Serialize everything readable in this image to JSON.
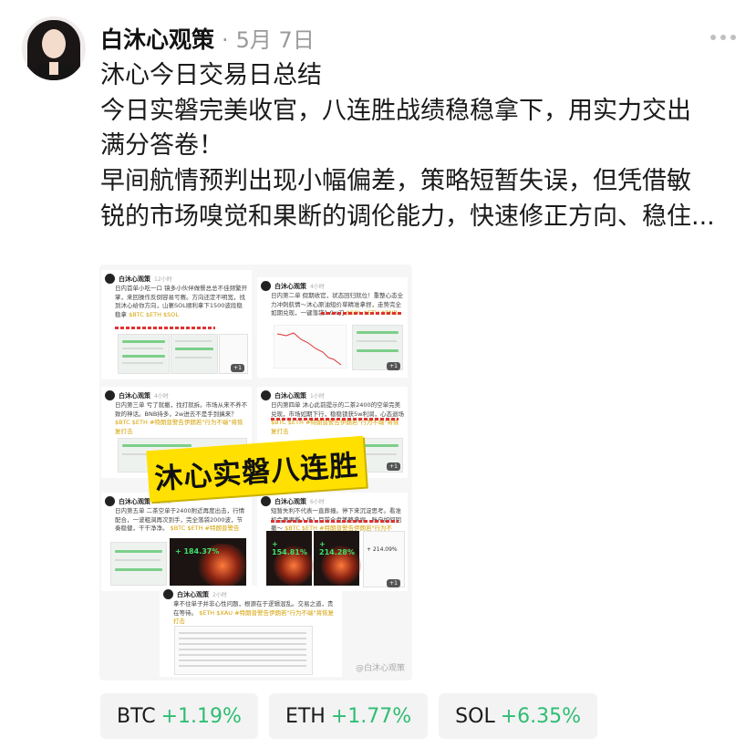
{
  "post": {
    "author": "白沐心观策",
    "separator": "·",
    "date": "5月 7日",
    "lines": [
      "沐心今日交易日总结",
      "今日实磐完美收官，八连胜战绩稳稳拿下，用实力交出",
      "满分答卷！",
      "早间航情预判出现小幅偏差，策略短暂失误，但凭借敏",
      "锐的市场嗅觉和果断的调伦能力，快速修正方向、稳住..."
    ]
  },
  "image": {
    "banner": "沐心实磐八连胜",
    "watermark": "@白沐心观策",
    "cards": [
      {
        "name": "白沐心观策",
        "time": "12小时",
        "text": "日内首单小吃一口 镜多小伙伴做餐总总不佳频繁开掌，来回操作反倒容易亏赛。方向还定不明宽，找到沐心给你方向，山寨SOL顺利拿下1500波段稳稳拿",
        "tags": "$BTC $ETH $SOL",
        "count": "+1"
      },
      {
        "name": "白沐心观策",
        "time": "4小时",
        "text": "日内第二单 假期收官，状态回归就位！重整心态全力冲刺航情～沐心原油短价草精准拿捏，走势完全如期兑现，一键落袋1.9w刀",
        "tags": "$SOL $ETH $BNB",
        "count": "+1"
      },
      {
        "name": "白沐心观策",
        "time": "4小时",
        "text": "日内第三单 亏了就撤，找打就拆。市场从来不养不致的神话。BNB持多，2w进去不是手到擒来？",
        "tags": "$BTC $ETH #特朗普警告伊朗若\"行为不端\"将恢复打击",
        "count": "+1"
      },
      {
        "name": "白沐心观策",
        "time": "1小时",
        "text": "日内第四单 沐心此前提示的二茶2400的空单完美兑现，市场如期下行，稳稳锁获5w利润，心态退场",
        "tags": "$BTC $ETH #特朗普警告伊朗若\"行为不端\"将恢复打击",
        "count": "+1"
      },
      {
        "name": "白沐心观策",
        "time": "13分钟",
        "text": "日内第五单 二茶空单于2400附近再度出击，行情配合，一波粗涧再次到手，完全落袋2000波，节奏稳健，干干净净。",
        "tags": "$BTC $ETH #特朗普警告",
        "count": "+1",
        "value": "+ 184.37%"
      },
      {
        "name": "白沐心观策",
        "time": "6小时",
        "text": "短暂失利不代表一直葬撞。停下来沉淀思考。看准机会再果断入场！目前全盘策略拿捏，账户如何回撤～",
        "tags": "$BTC $ETH #特朗普警告伊朗若\"行为不端\"将恢复打击",
        "count": "+1",
        "value": "+ 154.81%",
        "value2": "+ 214.28%",
        "value3": "+ 214.09%"
      },
      {
        "name": "白沐心观策",
        "time": "2小时",
        "text": "拿不住单子并非心性问题，根源在于逻辑混乱。交易之道，贵在等待。",
        "tags": "$ETH $XAU #特朗普警告伊朗若\"行为不端\"将恢复打击"
      }
    ]
  },
  "tickers": [
    {
      "symbol": "BTC",
      "change": "+1.19%"
    },
    {
      "symbol": "ETH",
      "change": "+1.77%"
    },
    {
      "symbol": "SOL",
      "change": "+6.35%"
    }
  ],
  "colors": {
    "positive": "#2ebd73",
    "banner": "#ffe000",
    "secondary": "#9a9a9a"
  },
  "icons": {
    "more": "more-horizontal-icon"
  }
}
